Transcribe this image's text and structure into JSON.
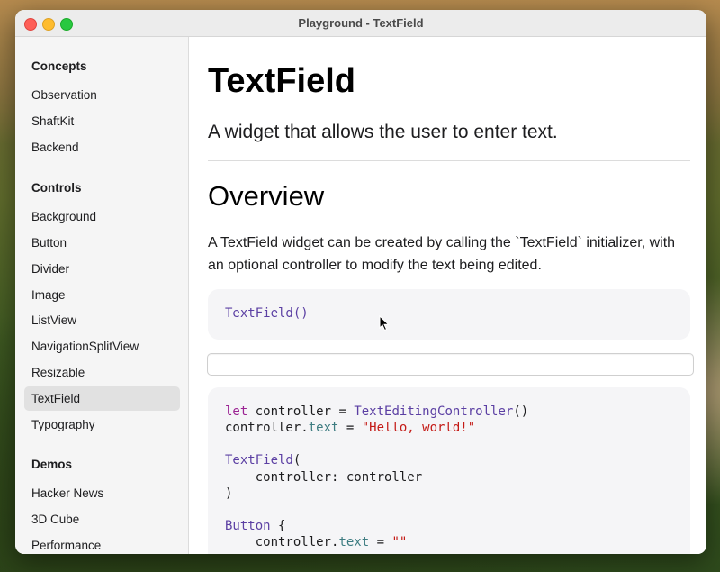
{
  "window": {
    "title": "Playground - TextField"
  },
  "sidebar": {
    "sections": [
      {
        "title": "Concepts",
        "items": [
          "Observation",
          "ShaftKit",
          "Backend"
        ]
      },
      {
        "title": "Controls",
        "items": [
          "Background",
          "Button",
          "Divider",
          "Image",
          "ListView",
          "NavigationSplitView",
          "Resizable",
          "TextField",
          "Typography"
        ]
      },
      {
        "title": "Demos",
        "items": [
          "Hacker News",
          "3D Cube",
          "Performance"
        ]
      }
    ],
    "selected": "TextField"
  },
  "content": {
    "title": "TextField",
    "subtitle": "A widget that allows the user to enter text.",
    "overview_heading": "Overview",
    "overview_text": "A TextField widget can be created by calling the `TextField` initializer, with an optional controller to modify the text being edited.",
    "code_sample_1": "TextField()",
    "text_field": {
      "value": "",
      "placeholder": ""
    },
    "code_sample_2": {
      "line1_kw": "let",
      "line1_name": " controller = ",
      "line1_type": "TextEditingController",
      "line1_end": "()",
      "line2_obj": "controller.",
      "line2_prop": "text",
      "line2_eq": " = ",
      "line2_str": "\"Hello, world!\"",
      "line4_type": "TextField",
      "line4_end": "(",
      "line5": "    controller: controller",
      "line6": ")",
      "line8_type": "Button",
      "line8_end": " {",
      "line9_indent": "    controller.",
      "line9_prop": "text",
      "line9_eq": " = ",
      "line9_str": "\"\""
    }
  },
  "colors": {
    "accent_keyword": "#9b2393",
    "accent_type": "#5b3fa3",
    "accent_property": "#3d7c81",
    "accent_string": "#c41a16"
  },
  "icons": {
    "close": "close-icon",
    "minimize": "minimize-icon",
    "maximize": "maximize-icon",
    "pointer": "mouse-pointer-icon"
  }
}
